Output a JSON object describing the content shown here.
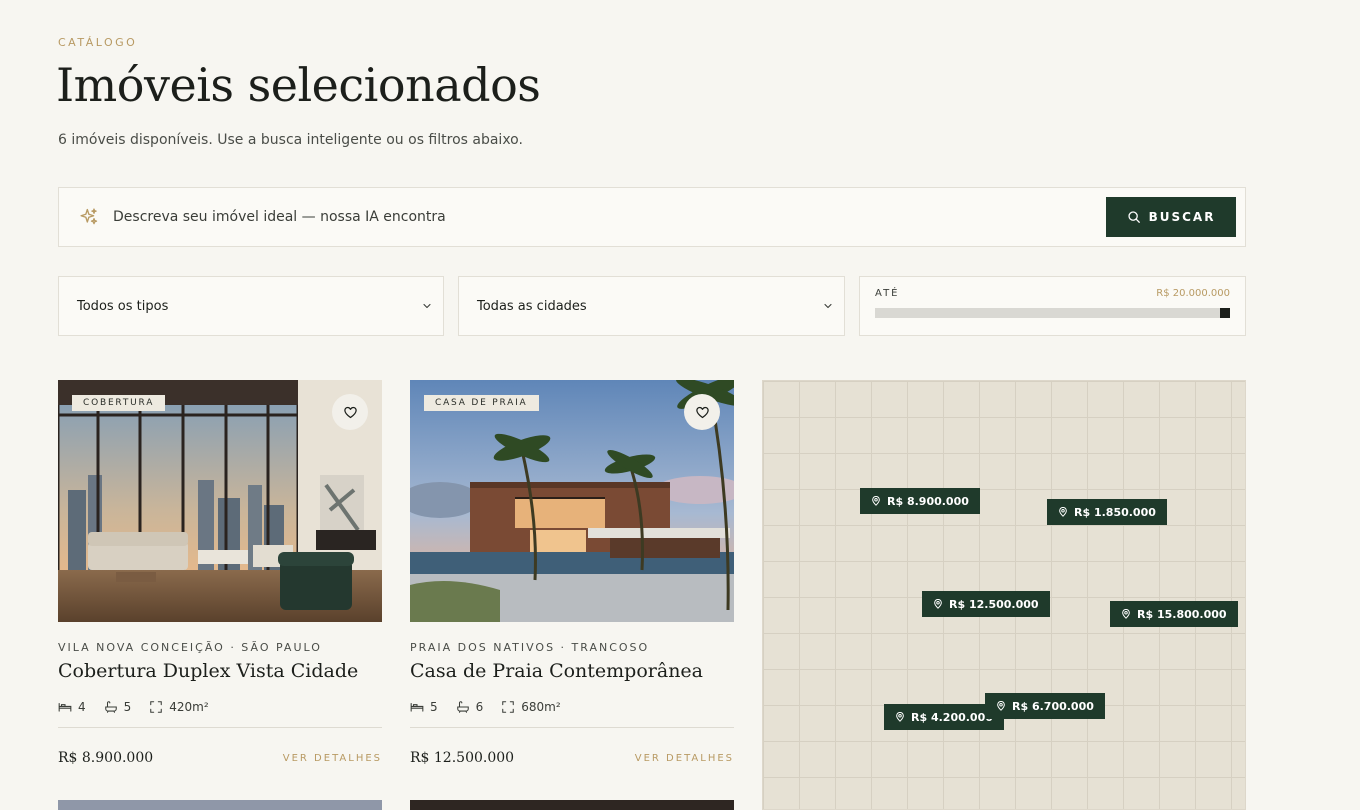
{
  "header": {
    "eyebrow": "CATÁLOGO",
    "title": "Imóveis selecionados",
    "subtitle": "6 imóveis disponíveis. Use a busca inteligente ou os filtros abaixo."
  },
  "ai_search": {
    "placeholder": "Descreva seu imóvel ideal — nossa IA encontra",
    "button_label": "BUSCAR"
  },
  "filters": {
    "type": {
      "selected": "Todos os tipos"
    },
    "city": {
      "selected": "Todas as cidades"
    },
    "price": {
      "label": "ATÉ",
      "max_value": "R$ 20.000.000",
      "slider_fraction": 1.0
    }
  },
  "properties": [
    {
      "tag": "COBERTURA",
      "location": "VILA NOVA CONCEIÇÃO · SÃO PAULO",
      "title": "Cobertura Duplex Vista Cidade",
      "beds": "4",
      "baths": "5",
      "area": "420m²",
      "price": "R$ 8.900.000",
      "cta": "VER DETALHES"
    },
    {
      "tag": "CASA DE PRAIA",
      "location": "PRAIA DOS NATIVOS · TRANCOSO",
      "title": "Casa de Praia Contemporânea",
      "beds": "5",
      "baths": "6",
      "area": "680m²",
      "price": "R$ 12.500.000",
      "cta": "VER DETALHES"
    }
  ],
  "map": {
    "pins": [
      {
        "label": "R$ 8.900.000"
      },
      {
        "label": "R$ 1.850.000"
      },
      {
        "label": "R$ 12.500.000"
      },
      {
        "label": "R$ 15.800.000"
      },
      {
        "label": "R$ 4.200.000"
      },
      {
        "label": "R$ 6.700.000"
      }
    ]
  },
  "colors": {
    "accent_gold": "#b89a63",
    "brand_green": "#1f3a2b",
    "background": "#f7f6f1"
  },
  "icons": {
    "ai": "sparkle-icon",
    "search": "search-icon",
    "dropdown": "chevron-down-icon",
    "favorite": "heart-icon",
    "beds": "bed-icon",
    "baths": "bath-icon",
    "area": "area-icon",
    "pin": "map-pin-icon"
  }
}
